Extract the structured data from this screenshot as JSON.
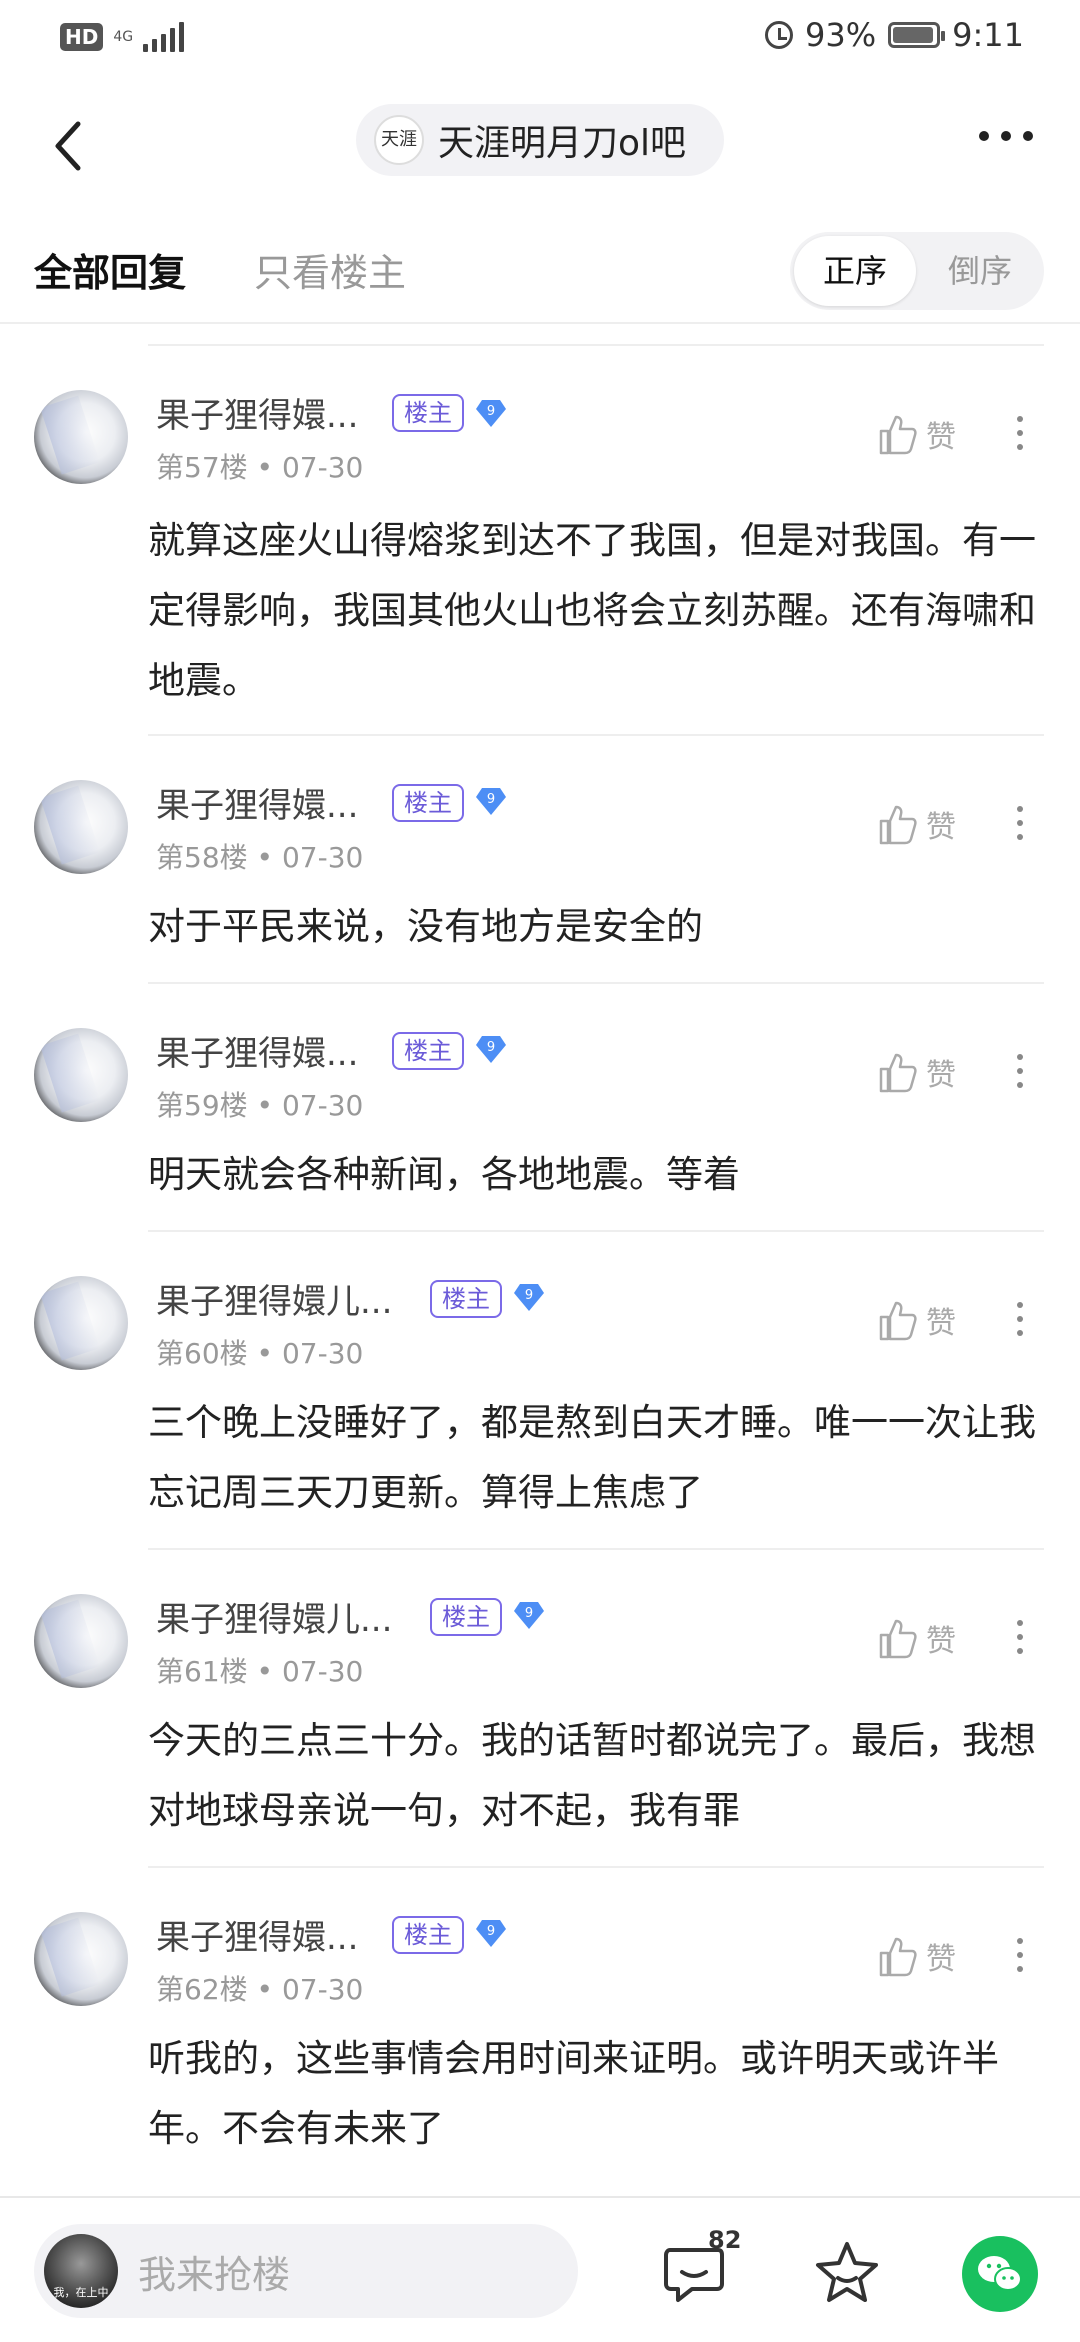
{
  "status_bar": {
    "hd": "HD",
    "network": "4G",
    "alarm_icon": "alarm-icon",
    "battery": "93%",
    "time": "9:11"
  },
  "header": {
    "forum_name": "天涯明月刀ol吧",
    "forum_avatar_text": "天涯"
  },
  "tabs": {
    "all_replies": "全部回复",
    "owner_only": "只看楼主"
  },
  "order": {
    "asc": "正序",
    "desc": "倒序"
  },
  "posts": [
    {
      "author": "果子狸得嬛...",
      "badge": "楼主",
      "level": "9",
      "floor": "第57楼",
      "date": "07-30",
      "like": "赞",
      "content": "就算这座火山得熔浆到达不了我国，但是对我国。有一定得影响，我国其他火山也将会立刻苏醒。还有海啸和地震。"
    },
    {
      "author": "果子狸得嬛...",
      "badge": "楼主",
      "level": "9",
      "floor": "第58楼",
      "date": "07-30",
      "like": "赞",
      "content": "对于平民来说，没有地方是安全的"
    },
    {
      "author": "果子狸得嬛...",
      "badge": "楼主",
      "level": "9",
      "floor": "第59楼",
      "date": "07-30",
      "like": "赞",
      "content": "明天就会各种新闻，各地地震。等着"
    },
    {
      "author": "果子狸得嬛儿...",
      "badge": "楼主",
      "level": "9",
      "floor": "第60楼",
      "date": "07-30",
      "like": "赞",
      "content": "三个晚上没睡好了，都是熬到白天才睡。唯一一次让我忘记周三天刀更新。算得上焦虑了"
    },
    {
      "author": "果子狸得嬛儿...",
      "badge": "楼主",
      "level": "9",
      "floor": "第61楼",
      "date": "07-30",
      "like": "赞",
      "content": "今天的三点三十分。我的话暂时都说完了。最后，我想对地球母亲说一句，对不起，我有罪"
    },
    {
      "author": "果子狸得嬛...",
      "badge": "楼主",
      "level": "9",
      "floor": "第62楼",
      "date": "07-30",
      "like": "赞",
      "content": "听我的，这些事情会用时间来证明。或许明天或许半年。不会有未来了"
    }
  ],
  "bottom": {
    "reply_placeholder": "我来抢楼",
    "avatar_text": "我，在上中",
    "comment_count": "82"
  },
  "colors": {
    "accent": "#7b6ae8",
    "level": "#4d8ef5",
    "wechat": "#19c05f"
  }
}
